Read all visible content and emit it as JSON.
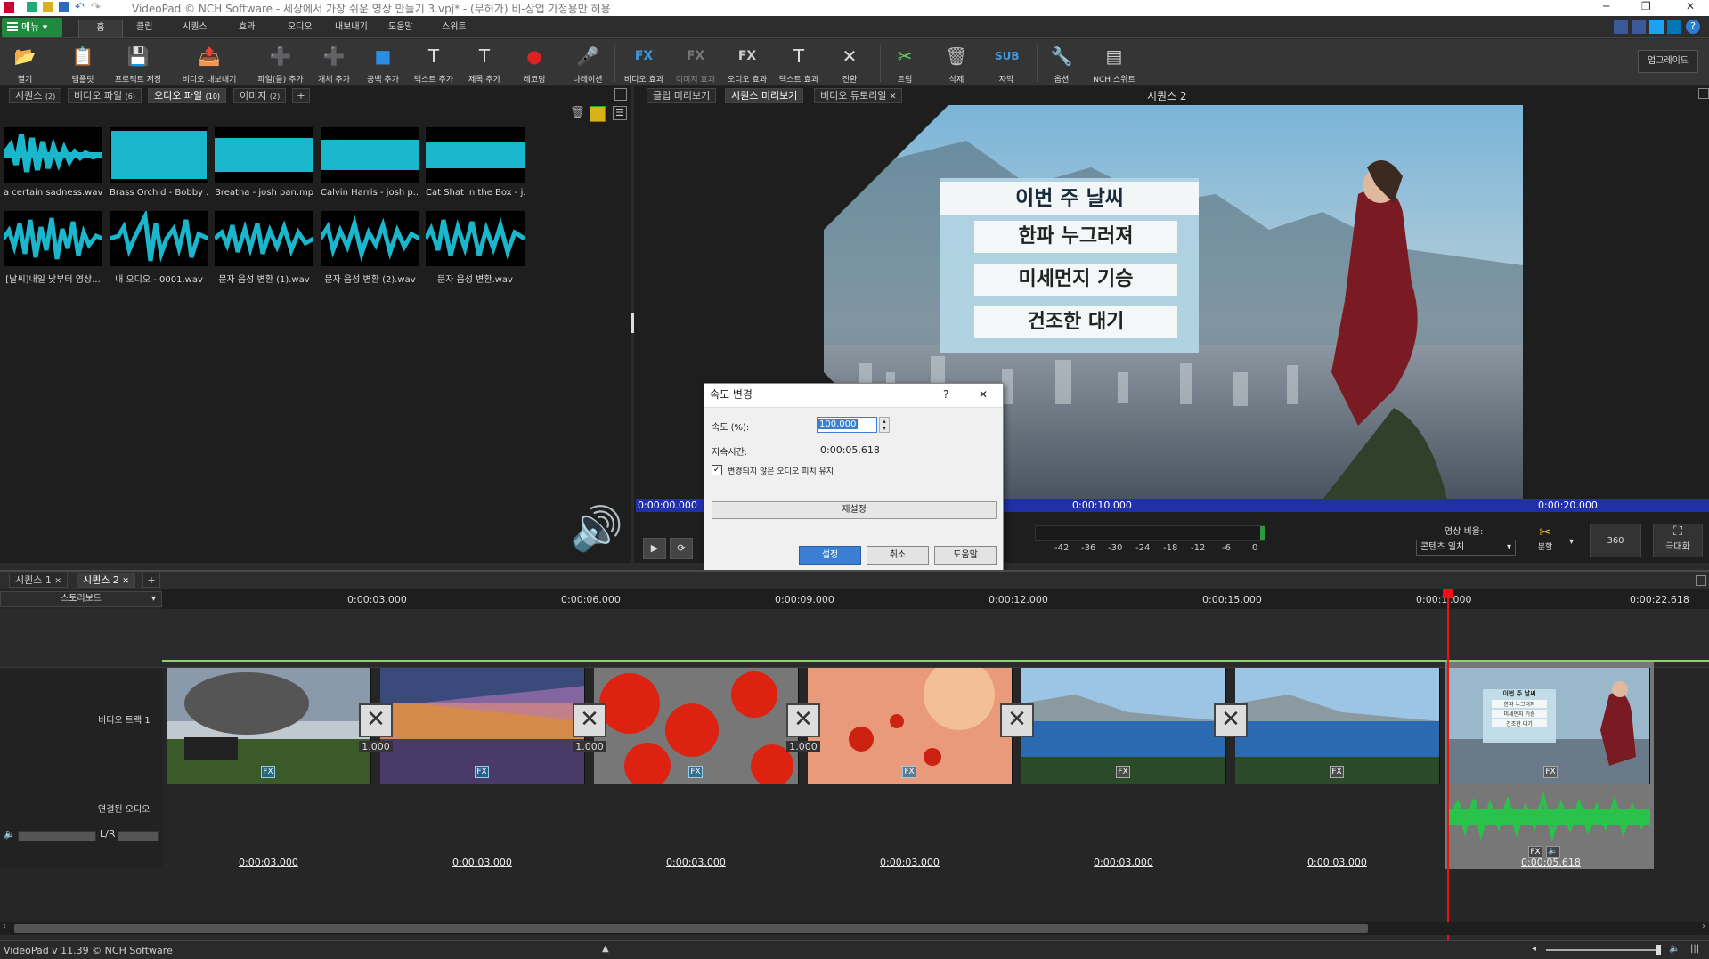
{
  "window": {
    "title": "VideoPad © NCH Software - 세상에서 가장 쉬운 영상 만들기 3.vpj* - (무허가) 비-상업 가정용만 허용",
    "minimize": "─",
    "restore": "❐",
    "close": "✕"
  },
  "menubar": {
    "menu_label": "메뉴",
    "tabs": [
      "홈",
      "클립",
      "시퀀스",
      "효과",
      "오디오",
      "내보내기",
      "도움말",
      "스위트"
    ]
  },
  "toolbar": {
    "buttons": [
      {
        "label": "열기",
        "icon": "📂"
      },
      {
        "label": "템플릿",
        "icon": "📋"
      },
      {
        "label": "프로젝트 저장",
        "icon": "💾"
      },
      {
        "label": "비디오 내보내기",
        "icon": "📤"
      },
      {
        "label": "파일(들) 추가",
        "icon": "➕"
      },
      {
        "label": "개체 추가",
        "icon": "➕"
      },
      {
        "label": "공백 추가",
        "icon": "■"
      },
      {
        "label": "텍스트 추가",
        "icon": "T"
      },
      {
        "label": "제목 추가",
        "icon": "T"
      },
      {
        "label": "레코딩",
        "icon": "●"
      },
      {
        "label": "나레이션",
        "icon": "🎤"
      },
      {
        "label": "비디오 효과",
        "icon": "FX"
      },
      {
        "label": "이미지 효과",
        "icon": "FX"
      },
      {
        "label": "오디오 효과",
        "icon": "FX"
      },
      {
        "label": "텍스트 효과",
        "icon": "T"
      },
      {
        "label": "전환",
        "icon": "✕"
      },
      {
        "label": "트림",
        "icon": "✂"
      },
      {
        "label": "삭제",
        "icon": "🗑"
      },
      {
        "label": "자막",
        "icon": "SUB"
      },
      {
        "label": "옵션",
        "icon": "🔧"
      },
      {
        "label": "NCH 스위트",
        "icon": "▤"
      }
    ],
    "upgrade_label": "업그레이드"
  },
  "media_bin": {
    "tabs": [
      {
        "label": "시퀀스",
        "count": "(2)"
      },
      {
        "label": "비디오 파일",
        "count": "(6)"
      },
      {
        "label": "오디오 파일",
        "count": "(10)"
      },
      {
        "label": "이미지",
        "count": "(2)"
      }
    ],
    "add_tab": "+",
    "clips": [
      "a certain sadness.wav",
      "Brass Orchid - Bobby ...",
      "Breatha - josh pan.mp3",
      "Calvin Harris - josh p...",
      "Cat Shat in the Box - j...",
      "[날씨]내일 낮부터 영상...",
      "내 오디오 - 0001.wav",
      "문자 음성 변환 (1).wav",
      "문자 음성 변환 (2).wav",
      "문자 음성 변환.wav"
    ]
  },
  "preview": {
    "tabs": [
      "클립 미리보기",
      "시퀀스 미리보기",
      "비디오 튜토리얼"
    ],
    "sequence_title": "시퀀스 2",
    "weather": {
      "title": "이번 주 날씨",
      "rows": [
        "한파 누그러져",
        "미세먼지 기승",
        "건조한 대기"
      ]
    },
    "time_marks": [
      "0:00:00.000",
      "0:00:10.000",
      "0:00:20.000"
    ],
    "meter_scale": [
      "-42",
      "-36",
      "-30",
      "-24",
      "-18",
      "-12",
      "-6",
      "0"
    ],
    "aspect_label": "영상 비율:",
    "aspect_value": "콘텐츠 일치",
    "split_label": "분할",
    "vr_label": "360",
    "fullscreen_label": "극대화"
  },
  "speed_dialog": {
    "title": "속도 변경",
    "help": "?",
    "close": "✕",
    "speed_label": "속도 (%):",
    "speed_value": "100.000",
    "duration_label": "지속시간:",
    "duration_value": "0:00:05.618",
    "keep_pitch_label": "변경되지 않은 오디오 피치 유지",
    "keep_pitch_checked": true,
    "reset_label": "재설정",
    "ok_label": "설정",
    "cancel_label": "취소",
    "help_label": "도움말"
  },
  "timeline": {
    "sequence_tabs": [
      "시퀀스 1",
      "시퀀스 2"
    ],
    "add_tab": "+",
    "mode": "스토리보드",
    "ruler": [
      "0:00:03.000",
      "0:00:06.000",
      "0:00:09.000",
      "0:00:12.000",
      "0:00:15.000",
      "0:00:1",
      ".000",
      "0:00:22.618"
    ],
    "video_track_label": "비디오 트랙 1",
    "audio_track_label": "연결된 오디오",
    "lr_label": "L/R",
    "transition_values": [
      "1.000",
      "1.000",
      "1.000"
    ],
    "fx_label": "FX",
    "durations": [
      "0:00:03.000",
      "0:00:03.000",
      "0:00:03.000",
      "0:00:03.000",
      "0:00:03.000",
      "0:00:03.000",
      "0:00:05.618"
    ],
    "thumb_weather": {
      "title": "이번 주 날씨",
      "rows": [
        "한파 누그러져",
        "미세먼지 기승",
        "건조한 대기"
      ]
    }
  },
  "status": {
    "version": "VideoPad v 11.39 © NCH Software"
  }
}
